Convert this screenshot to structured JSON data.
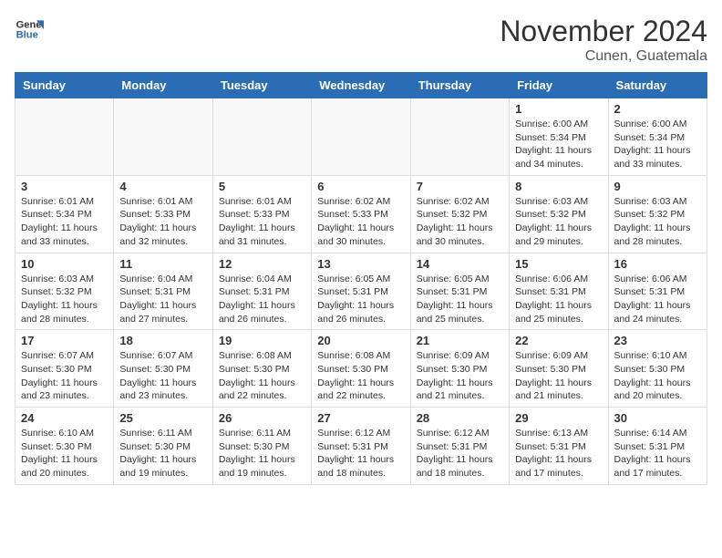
{
  "header": {
    "logo_general": "General",
    "logo_blue": "Blue",
    "month_title": "November 2024",
    "location": "Cunen, Guatemala"
  },
  "days_of_week": [
    "Sunday",
    "Monday",
    "Tuesday",
    "Wednesday",
    "Thursday",
    "Friday",
    "Saturday"
  ],
  "weeks": [
    [
      {
        "day": "",
        "info": ""
      },
      {
        "day": "",
        "info": ""
      },
      {
        "day": "",
        "info": ""
      },
      {
        "day": "",
        "info": ""
      },
      {
        "day": "",
        "info": ""
      },
      {
        "day": "1",
        "info": "Sunrise: 6:00 AM\nSunset: 5:34 PM\nDaylight: 11 hours\nand 34 minutes."
      },
      {
        "day": "2",
        "info": "Sunrise: 6:00 AM\nSunset: 5:34 PM\nDaylight: 11 hours\nand 33 minutes."
      }
    ],
    [
      {
        "day": "3",
        "info": "Sunrise: 6:01 AM\nSunset: 5:34 PM\nDaylight: 11 hours\nand 33 minutes."
      },
      {
        "day": "4",
        "info": "Sunrise: 6:01 AM\nSunset: 5:33 PM\nDaylight: 11 hours\nand 32 minutes."
      },
      {
        "day": "5",
        "info": "Sunrise: 6:01 AM\nSunset: 5:33 PM\nDaylight: 11 hours\nand 31 minutes."
      },
      {
        "day": "6",
        "info": "Sunrise: 6:02 AM\nSunset: 5:33 PM\nDaylight: 11 hours\nand 30 minutes."
      },
      {
        "day": "7",
        "info": "Sunrise: 6:02 AM\nSunset: 5:32 PM\nDaylight: 11 hours\nand 30 minutes."
      },
      {
        "day": "8",
        "info": "Sunrise: 6:03 AM\nSunset: 5:32 PM\nDaylight: 11 hours\nand 29 minutes."
      },
      {
        "day": "9",
        "info": "Sunrise: 6:03 AM\nSunset: 5:32 PM\nDaylight: 11 hours\nand 28 minutes."
      }
    ],
    [
      {
        "day": "10",
        "info": "Sunrise: 6:03 AM\nSunset: 5:32 PM\nDaylight: 11 hours\nand 28 minutes."
      },
      {
        "day": "11",
        "info": "Sunrise: 6:04 AM\nSunset: 5:31 PM\nDaylight: 11 hours\nand 27 minutes."
      },
      {
        "day": "12",
        "info": "Sunrise: 6:04 AM\nSunset: 5:31 PM\nDaylight: 11 hours\nand 26 minutes."
      },
      {
        "day": "13",
        "info": "Sunrise: 6:05 AM\nSunset: 5:31 PM\nDaylight: 11 hours\nand 26 minutes."
      },
      {
        "day": "14",
        "info": "Sunrise: 6:05 AM\nSunset: 5:31 PM\nDaylight: 11 hours\nand 25 minutes."
      },
      {
        "day": "15",
        "info": "Sunrise: 6:06 AM\nSunset: 5:31 PM\nDaylight: 11 hours\nand 25 minutes."
      },
      {
        "day": "16",
        "info": "Sunrise: 6:06 AM\nSunset: 5:31 PM\nDaylight: 11 hours\nand 24 minutes."
      }
    ],
    [
      {
        "day": "17",
        "info": "Sunrise: 6:07 AM\nSunset: 5:30 PM\nDaylight: 11 hours\nand 23 minutes."
      },
      {
        "day": "18",
        "info": "Sunrise: 6:07 AM\nSunset: 5:30 PM\nDaylight: 11 hours\nand 23 minutes."
      },
      {
        "day": "19",
        "info": "Sunrise: 6:08 AM\nSunset: 5:30 PM\nDaylight: 11 hours\nand 22 minutes."
      },
      {
        "day": "20",
        "info": "Sunrise: 6:08 AM\nSunset: 5:30 PM\nDaylight: 11 hours\nand 22 minutes."
      },
      {
        "day": "21",
        "info": "Sunrise: 6:09 AM\nSunset: 5:30 PM\nDaylight: 11 hours\nand 21 minutes."
      },
      {
        "day": "22",
        "info": "Sunrise: 6:09 AM\nSunset: 5:30 PM\nDaylight: 11 hours\nand 21 minutes."
      },
      {
        "day": "23",
        "info": "Sunrise: 6:10 AM\nSunset: 5:30 PM\nDaylight: 11 hours\nand 20 minutes."
      }
    ],
    [
      {
        "day": "24",
        "info": "Sunrise: 6:10 AM\nSunset: 5:30 PM\nDaylight: 11 hours\nand 20 minutes."
      },
      {
        "day": "25",
        "info": "Sunrise: 6:11 AM\nSunset: 5:30 PM\nDaylight: 11 hours\nand 19 minutes."
      },
      {
        "day": "26",
        "info": "Sunrise: 6:11 AM\nSunset: 5:30 PM\nDaylight: 11 hours\nand 19 minutes."
      },
      {
        "day": "27",
        "info": "Sunrise: 6:12 AM\nSunset: 5:31 PM\nDaylight: 11 hours\nand 18 minutes."
      },
      {
        "day": "28",
        "info": "Sunrise: 6:12 AM\nSunset: 5:31 PM\nDaylight: 11 hours\nand 18 minutes."
      },
      {
        "day": "29",
        "info": "Sunrise: 6:13 AM\nSunset: 5:31 PM\nDaylight: 11 hours\nand 17 minutes."
      },
      {
        "day": "30",
        "info": "Sunrise: 6:14 AM\nSunset: 5:31 PM\nDaylight: 11 hours\nand 17 minutes."
      }
    ]
  ]
}
